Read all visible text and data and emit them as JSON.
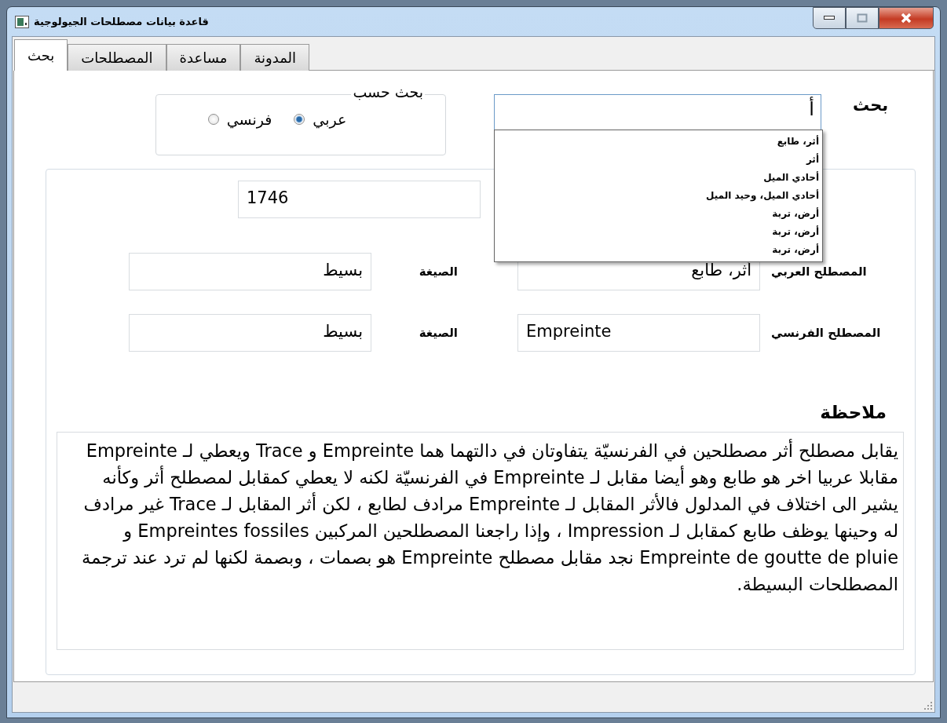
{
  "window": {
    "title": "قاعدة بيانات مصطلحات الجيولوجية"
  },
  "tabs": [
    {
      "label": "المدونة",
      "selected": false
    },
    {
      "label": "مساعدة",
      "selected": false
    },
    {
      "label": "المصطلحات",
      "selected": false
    },
    {
      "label": "بحث",
      "selected": true
    }
  ],
  "search_by": {
    "legend": "بحث حسب",
    "options": [
      {
        "label": "عربي",
        "selected": true
      },
      {
        "label": "فرنسي",
        "selected": false
      }
    ]
  },
  "search": {
    "label": "بحث",
    "value": "أ"
  },
  "suggestions": [
    "أثر، طابع",
    "أثر",
    "أحادي الميل",
    "أحادي الميل، وحيد الميل",
    "أرض، تربة",
    "أرض، تربة",
    "أرض، تربة"
  ],
  "record": {
    "id": "1746",
    "rows": [
      {
        "term_label": "المصطلح العربي",
        "term_value": "أثر، طابع",
        "form_label": "الصيغة",
        "form_value": "بسيط"
      },
      {
        "term_label": "المصطلح الفرنسي",
        "term_value": "Empreinte",
        "form_label": "الصيغة",
        "form_value": "بسيط"
      }
    ],
    "note_label": "ملاحظة",
    "note": "يقابل مصطلح أثر مصطلحين في الفرنسيّة يتفاوتان في دالتهما هما Empreinte و Trace ويعطي لـ  Empreinte مقابلا عربيا اخر هو طابع وهو أيضا مقابل لـ Empreinte في الفرنسيّة لكنه لا يعطي كمقابل لمصطلح أثر وكأنه يشير الى اختلاف في المدلول فالأثر المقابل لـ Empreinte مرادف لطابع ، لكن أثر المقابل لـ Trace غير مرادف له وحينها يوظف طابع كمقابل لـ Impression ، وإذا راجعنا المصطلحين المركبين Empreintes fossiles و Empreinte de goutte de pluie نجد مقابل مصطلح Empreinte هو بصمات ، وبصمة لكنها لم ترد عند ترجمة المصطلحات البسيطة."
  }
}
